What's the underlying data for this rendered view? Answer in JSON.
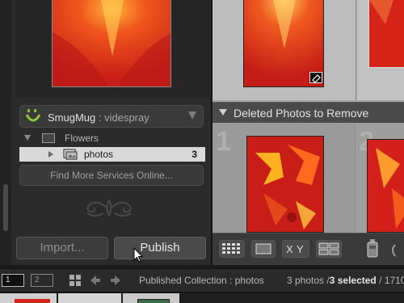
{
  "publish_services": {
    "service_name": "SmugMug",
    "separator": " : ",
    "account": "videspray",
    "collection_set": {
      "label": "Flowers"
    },
    "collection": {
      "label": "photos",
      "count": "3"
    },
    "find_more_button": "Find More Services Online..."
  },
  "bottom_buttons": {
    "import": "Import...",
    "publish": "Publish"
  },
  "grid": {
    "deleted_section_label": "Deleted Photos to Remove",
    "cell_numbers": [
      "1",
      "2"
    ]
  },
  "filmstrip_bar": {
    "screen_1": "1",
    "screen_2": "2",
    "source": "Published Collection : photos",
    "photo_count": "3 photos /",
    "selected": "3 selected",
    "trailing": " / 1710"
  },
  "icons": [
    "smugmug-logo-icon",
    "collection-set-icon",
    "collection-icon",
    "ornament-icon",
    "badge-icon",
    "grid-view-icon",
    "loupe-view-icon",
    "compare-view-icon",
    "survey-view-icon",
    "spray-can-icon",
    "grid-small-icon",
    "back-arrow-icon",
    "forward-arrow-icon",
    "cursor-icon"
  ],
  "colors": {
    "smugmug_green": "#8dc63f",
    "selected_row": "#d9d9d9",
    "photo_red": "#d4231b"
  }
}
